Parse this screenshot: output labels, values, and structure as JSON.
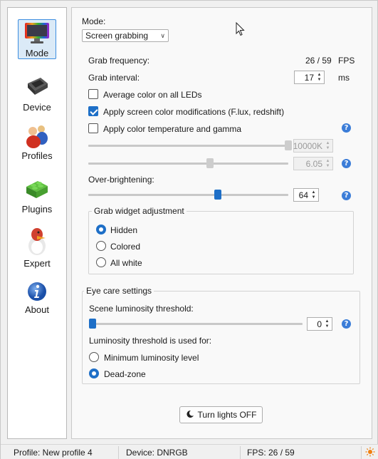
{
  "sidebar": {
    "items": [
      {
        "label": "Mode",
        "icon": "monitor-icon"
      },
      {
        "label": "Device",
        "icon": "chip-icon"
      },
      {
        "label": "Profiles",
        "icon": "people-icon"
      },
      {
        "label": "Plugins",
        "icon": "lego-brick-icon"
      },
      {
        "label": "Expert",
        "icon": "penguin-icon"
      },
      {
        "label": "About",
        "icon": "info-icon"
      }
    ]
  },
  "main": {
    "mode_label": "Mode:",
    "mode_value": "Screen grabbing",
    "grab_frequency_label": "Grab frequency:",
    "grab_frequency_value": "26 / 59",
    "grab_frequency_unit": "FPS",
    "grab_interval_label": "Grab interval:",
    "grab_interval_value": "17",
    "grab_interval_unit": "ms",
    "avg_color_label": "Average color on all LEDs",
    "avg_color_checked": false,
    "apply_mods_label": "Apply screen color modifications (F.lux, redshift)",
    "apply_mods_checked": true,
    "color_temp_label": "Apply color temperature and gamma",
    "color_temp_checked": false,
    "color_temp_value": "10000K",
    "color_temp_level": 1.0,
    "gamma_value": "6.05",
    "gamma_level": 0.6,
    "over_brightening_label": "Over-brightening:",
    "over_brightening_value": "64",
    "over_brightening_level": 0.64,
    "grab_widget": {
      "title": "Grab widget adjustment",
      "options": [
        "Hidden",
        "Colored",
        "All white"
      ],
      "selected": "Hidden"
    },
    "eye_care": {
      "title": "Eye care settings",
      "threshold_label": "Scene luminosity threshold:",
      "threshold_value": "0",
      "threshold_level": 0.0,
      "usage_label": "Luminosity threshold is used for:",
      "options": [
        "Minimum luminosity level",
        "Dead-zone"
      ],
      "selected": "Dead-zone"
    },
    "turn_off_button": "Turn lights OFF"
  },
  "status": {
    "profile": "Profile: New profile 4",
    "device": "Device: DNRGB",
    "fps": "FPS: 26 / 59"
  },
  "colors": {
    "accent": "#1e6fc7",
    "help": "#3b7dd8",
    "active_tab": "#dbeaf7"
  }
}
